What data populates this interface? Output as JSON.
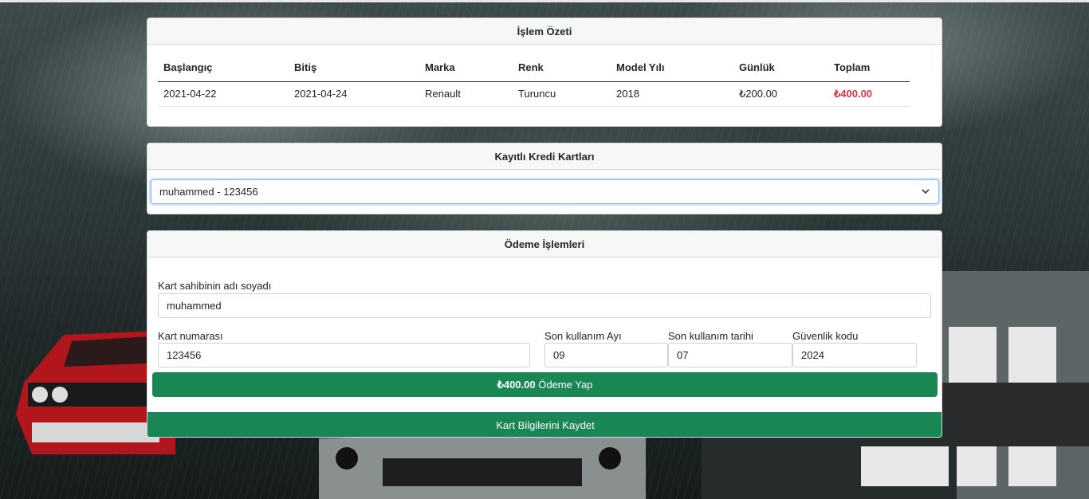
{
  "summary": {
    "title": "İşlem Özeti",
    "columns": [
      "Başlangıç",
      "Bitiş",
      "Marka",
      "Renk",
      "Model Yılı",
      "Günlük",
      "Toplam"
    ],
    "row": {
      "start": "2021-04-22",
      "end": "2021-04-24",
      "brand": "Renault",
      "color": "Turuncu",
      "model_year": "2018",
      "daily": "₺200.00",
      "total": "₺400.00"
    }
  },
  "saved_cards": {
    "title": "Kayıtlı Kredi Kartları",
    "selected": "muhammed - 123456"
  },
  "payment": {
    "title": "Ödeme İşlemleri",
    "holder_label": "Kart sahibinin adı soyadı",
    "holder_value": "muhammed",
    "number_label": "Kart numarası",
    "number_value": "123456",
    "month_label": "Son kullanım Ayı",
    "month_value": "09",
    "year_label": "Son kullanım tarihi",
    "year_value": "07",
    "cvv_label": "Güvenlik kodu",
    "cvv_value": "2024",
    "pay_amount": "₺400.00",
    "pay_label": "Ödeme Yap",
    "save_label": "Kart Bilgilerini Kaydet"
  },
  "colors": {
    "accent_green": "#198754",
    "total_red": "#dc3545",
    "focus_blue": "#86b7fe"
  }
}
